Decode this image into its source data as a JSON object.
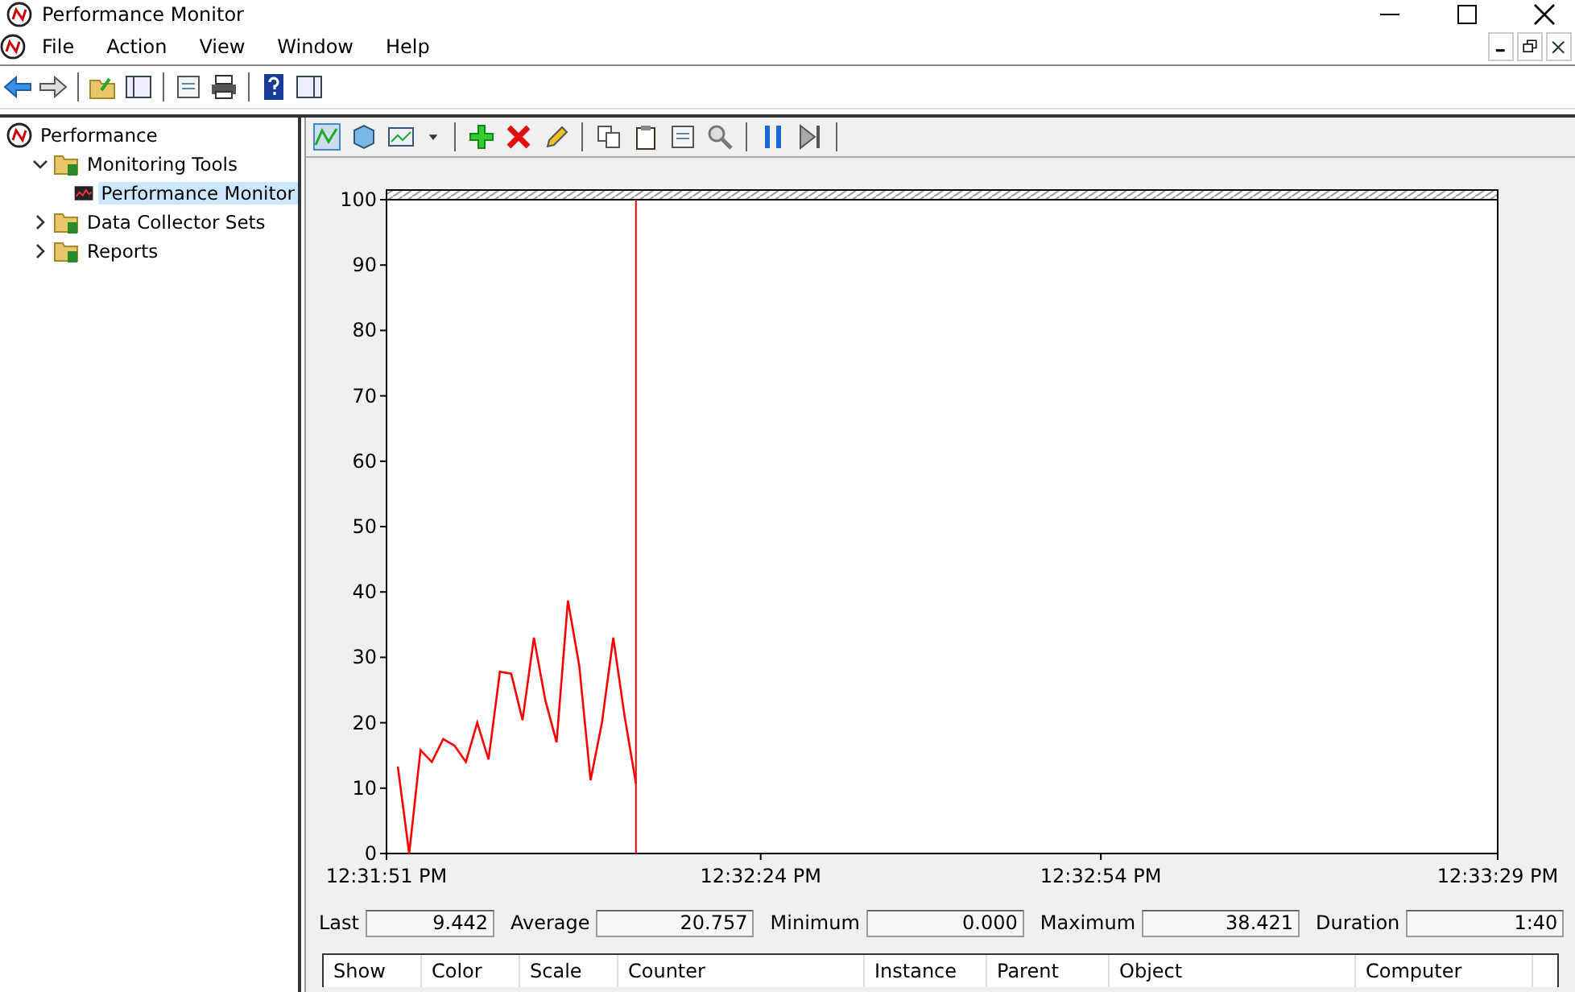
{
  "window": {
    "title": "Performance Monitor"
  },
  "menu": [
    "File",
    "Action",
    "View",
    "Window",
    "Help"
  ],
  "tree": [
    {
      "label": "Performance",
      "selected": false,
      "kind": "root",
      "children": [
        {
          "label": "Monitoring Tools",
          "expanded": true,
          "selected": false,
          "kind": "folder",
          "children": [
            {
              "label": "Performance Monitor",
              "selected": true,
              "kind": "monitor"
            }
          ]
        },
        {
          "label": "Data Collector Sets",
          "expanded": false,
          "selected": false,
          "kind": "folder"
        },
        {
          "label": "Reports",
          "expanded": false,
          "selected": false,
          "kind": "folder"
        }
      ]
    }
  ],
  "chart": {
    "chart_data": {
      "type": "line",
      "ylim": [
        0,
        100
      ],
      "yticks": [
        0,
        10,
        20,
        30,
        40,
        50,
        60,
        70,
        80,
        90,
        100
      ],
      "categories": [
        "12:31:51 PM",
        null,
        null,
        null,
        null,
        null,
        null,
        null,
        null,
        null,
        null,
        null,
        null,
        null,
        null,
        null,
        null,
        null,
        null,
        null,
        null,
        null,
        null,
        null,
        null,
        null,
        null,
        null,
        null,
        null,
        null,
        null,
        null,
        "12:32:24 PM",
        null,
        null,
        null,
        null,
        null,
        null,
        null,
        null,
        null,
        null,
        null,
        null,
        null,
        null,
        null,
        null,
        null,
        null,
        null,
        null,
        null,
        null,
        null,
        null,
        null,
        null,
        null,
        null,
        null,
        "12:32:54 PM",
        null,
        null,
        null,
        null,
        null,
        null,
        null,
        null,
        null,
        null,
        null,
        null,
        null,
        null,
        null,
        null,
        null,
        null,
        null,
        null,
        null,
        null,
        null,
        null,
        null,
        null,
        null,
        null,
        null,
        null,
        null,
        null,
        null,
        null,
        "12:33:29 PM"
      ],
      "series": [
        {
          "color": "#ff0000",
          "values": [
            null,
            13.3,
            0,
            15.8,
            14,
            17.5,
            16.5,
            14,
            20,
            14.4,
            27.8,
            27.5,
            20.4,
            33,
            23.5,
            17,
            38.7,
            28.7,
            11.2,
            20,
            33,
            21,
            10.7,
            null,
            null,
            null,
            null,
            null,
            null,
            null,
            null,
            null,
            null,
            null,
            null,
            null,
            null,
            null,
            null,
            null,
            null,
            null,
            null,
            null,
            null,
            null,
            null,
            null,
            null,
            null,
            null,
            null,
            null,
            null,
            null,
            null,
            null,
            null,
            null,
            null,
            null,
            null,
            null,
            null,
            null,
            null,
            null,
            null,
            null,
            null,
            null,
            null,
            null,
            null,
            null,
            null,
            null,
            null,
            null,
            null,
            null,
            null,
            null,
            null,
            null,
            null,
            null,
            null,
            null,
            null,
            null,
            null,
            null,
            null,
            null,
            null,
            null,
            null,
            null
          ]
        }
      ]
    }
  },
  "stats": [
    {
      "label": "Last",
      "value": "9.442"
    },
    {
      "label": "Average",
      "value": "20.757"
    },
    {
      "label": "Minimum",
      "value": "0.000"
    },
    {
      "label": "Maximum",
      "value": "38.421"
    },
    {
      "label": "Duration",
      "value": "1:40"
    }
  ],
  "table": {
    "columns": [
      "Show",
      "Color",
      "Scale",
      "Counter",
      "Instance",
      "Parent",
      "Object",
      "Computer"
    ]
  }
}
